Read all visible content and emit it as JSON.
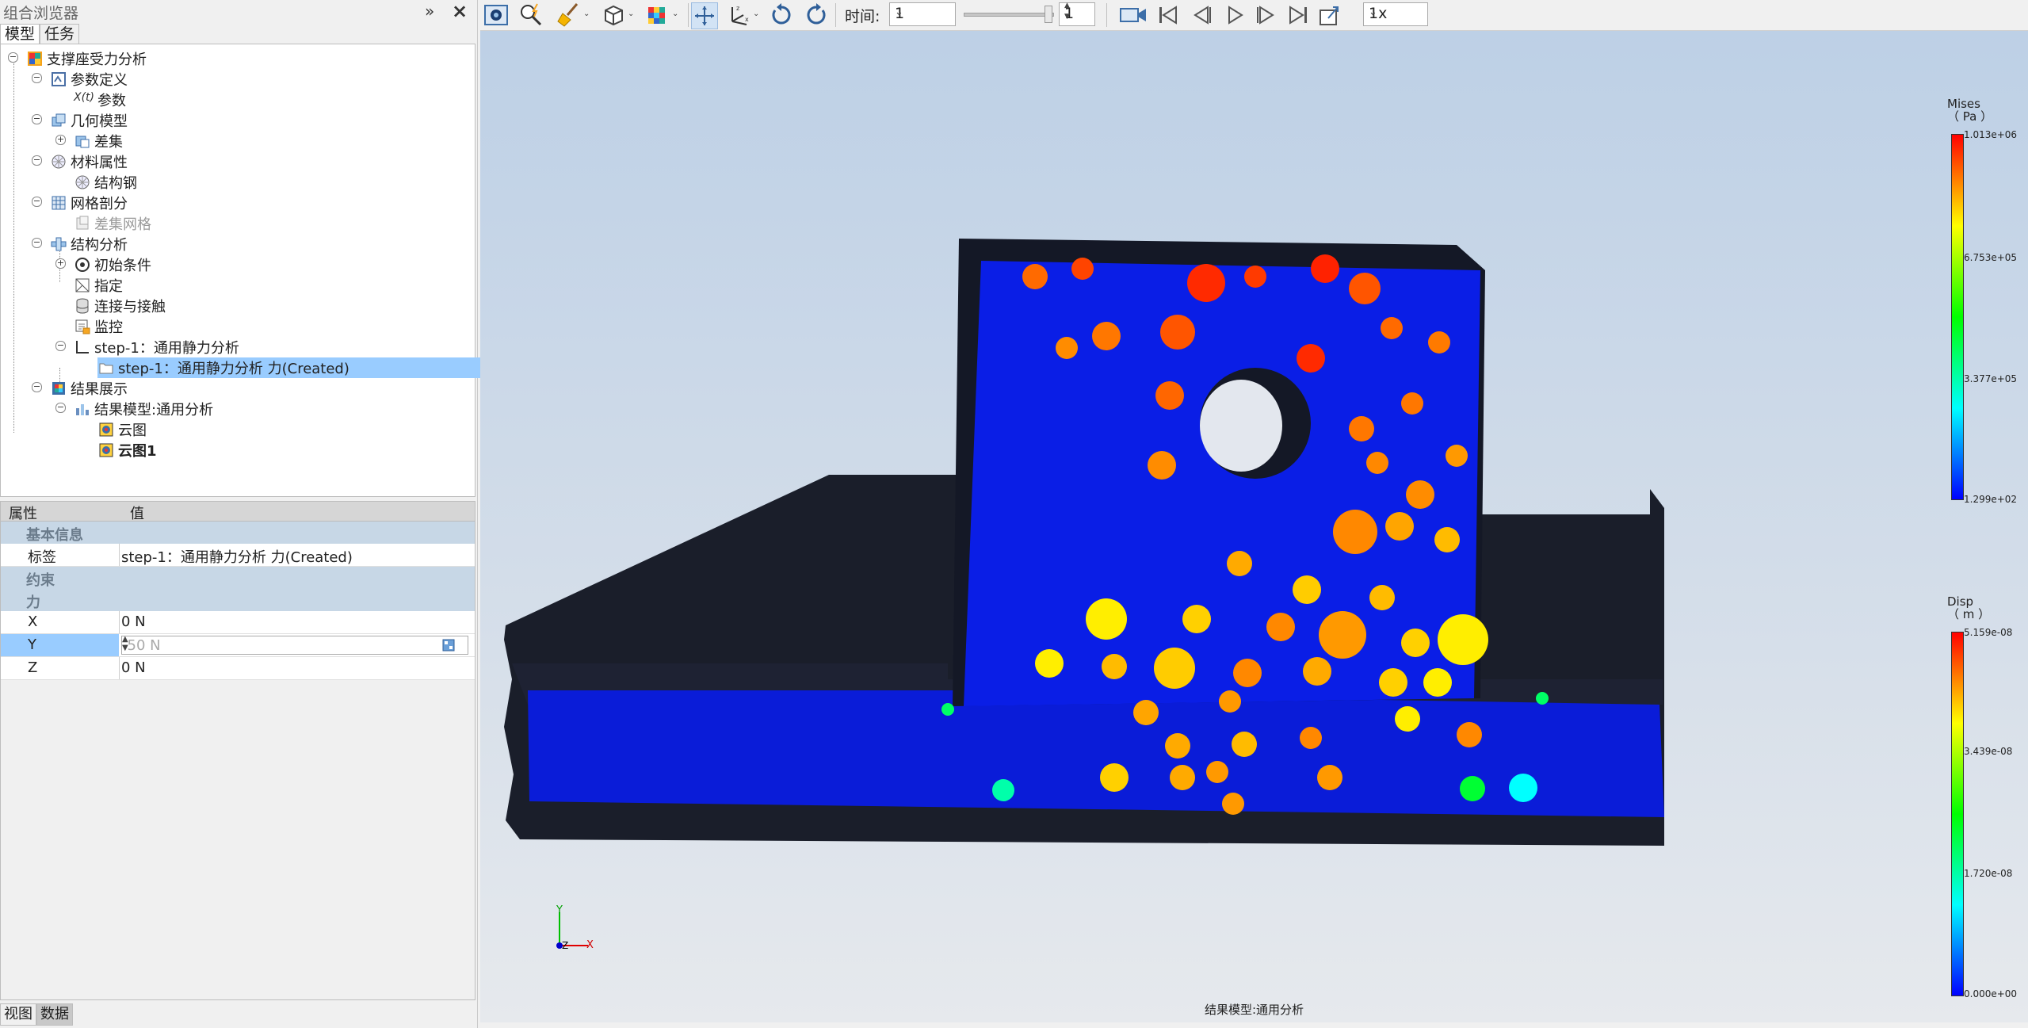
{
  "browser": {
    "title": "组合浏览器",
    "pin_icon": "double-chevron-right-icon",
    "close_icon": "close-icon",
    "tabs": [
      "模型",
      "任务"
    ],
    "bottom_tabs": [
      "视图",
      "数据"
    ]
  },
  "tree": {
    "root": "支撑座受力分析",
    "param_def": "参数定义",
    "param_sub": "参数",
    "param_sub_icon_text": "X(t)",
    "geometry": "几何模型",
    "diff": "差集",
    "material": "材料属性",
    "steel": "结构钢",
    "mesh": "网格剖分",
    "diff_mesh": "差集网格",
    "struct": "结构分析",
    "initial": "初始条件",
    "assign": "指定",
    "connection": "连接与接触",
    "monitor": "监控",
    "step": "step-1：通用静力分析",
    "step_force": "step-1：通用静力分析 力(Created)",
    "results": "结果展示",
    "result_model": "结果模型:通用分析",
    "contour": "云图",
    "contour1": "云图1"
  },
  "props": {
    "col_key": "属性",
    "col_value": "值",
    "group_basic": "基本信息",
    "label_key": "标签",
    "label_value": "step-1：通用静力分析 力(Created)",
    "group_constraint": "约束",
    "group_force": "力",
    "x_key": "X",
    "x_value": "0 N",
    "y_key": "Y",
    "y_value": "-50 N",
    "z_key": "Z",
    "z_value": "0 N"
  },
  "toolbar": {
    "time_label": "时间:",
    "time_value": "1",
    "frame_value": "1",
    "speed_value": "1x",
    "icons": [
      "screenshot-icon",
      "zoom-lightning-icon",
      "broom-icon",
      "cube-view-icon",
      "color-cube-icon",
      "fit-view-icon",
      "axes-icon",
      "rotate-left-icon",
      "rotate-right-icon",
      "camera-record-icon",
      "first-frame-icon",
      "prev-frame-icon",
      "play-icon",
      "next-frame-icon",
      "last-frame-icon",
      "export-icon"
    ]
  },
  "viewport": {
    "footer_title": "结果模型:通用分析",
    "axis_y": "Y",
    "axis_x": "X",
    "axis_z": "Z"
  },
  "legend_mises": {
    "title_line1": "Mises",
    "title_line2": "（ Pa ）",
    "labels": [
      "1.013e+06",
      "6.753e+05",
      "3.377e+05",
      "1.299e+02"
    ],
    "colors": [
      "#ff0000",
      "#ffff00",
      "#00ff00",
      "#00ffff",
      "#0000ff"
    ]
  },
  "legend_disp": {
    "title_line1": "Disp",
    "title_line2": "（ m ）",
    "labels": [
      "5.159e-08",
      "3.439e-08",
      "1.720e-08",
      "0.000e+00"
    ],
    "colors": [
      "#ff0000",
      "#ffff00",
      "#00ff00",
      "#00ffff",
      "#0000ff"
    ]
  }
}
